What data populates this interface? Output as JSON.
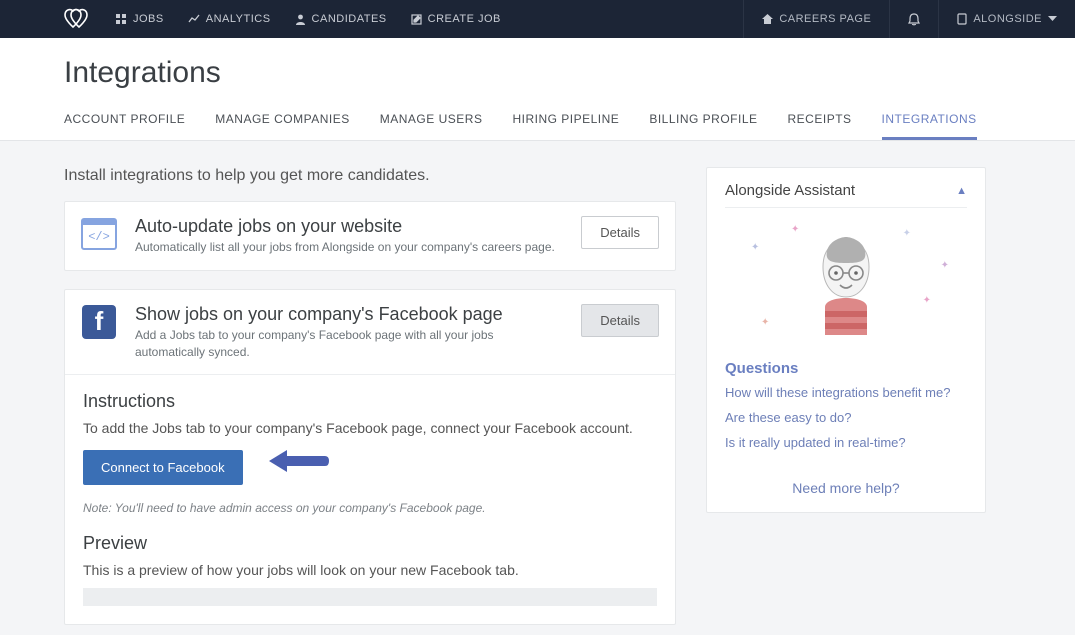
{
  "nav": {
    "items": [
      {
        "label": "JOBS"
      },
      {
        "label": "ANALYTICS"
      },
      {
        "label": "CANDIDATES"
      },
      {
        "label": "CREATE JOB"
      }
    ],
    "careers": "CAREERS PAGE",
    "account": "ALONGSIDE"
  },
  "page": {
    "title": "Integrations"
  },
  "tabs": [
    {
      "label": "ACCOUNT PROFILE"
    },
    {
      "label": "MANAGE COMPANIES"
    },
    {
      "label": "MANAGE USERS"
    },
    {
      "label": "HIRING PIPELINE"
    },
    {
      "label": "BILLING PROFILE"
    },
    {
      "label": "RECEIPTS"
    },
    {
      "label": "INTEGRATIONS"
    }
  ],
  "intro": "Install integrations to help you get more candidates.",
  "integrations": [
    {
      "title": "Auto-update jobs on your website",
      "desc": "Automatically list all your jobs from Alongside on your company's careers page.",
      "button": "Details"
    },
    {
      "title": "Show jobs on your company's Facebook page",
      "desc": "Add a Jobs tab to your company's Facebook page with all your jobs automatically synced.",
      "button": "Details"
    }
  ],
  "instructions": {
    "heading": "Instructions",
    "text": "To add the Jobs tab to your company's Facebook page, connect your Facebook account.",
    "cta": "Connect to Facebook",
    "note": "Note: You'll need to have admin access on your company's Facebook page."
  },
  "preview": {
    "heading": "Preview",
    "text": "This is a preview of how your jobs will look on your new Facebook tab."
  },
  "assistant": {
    "title": "Alongside Assistant",
    "questions_heading": "Questions",
    "links": [
      "How will these integrations benefit me?",
      "Are these easy to do?",
      "Is it really updated in real-time?"
    ],
    "more": "Need more help?"
  }
}
